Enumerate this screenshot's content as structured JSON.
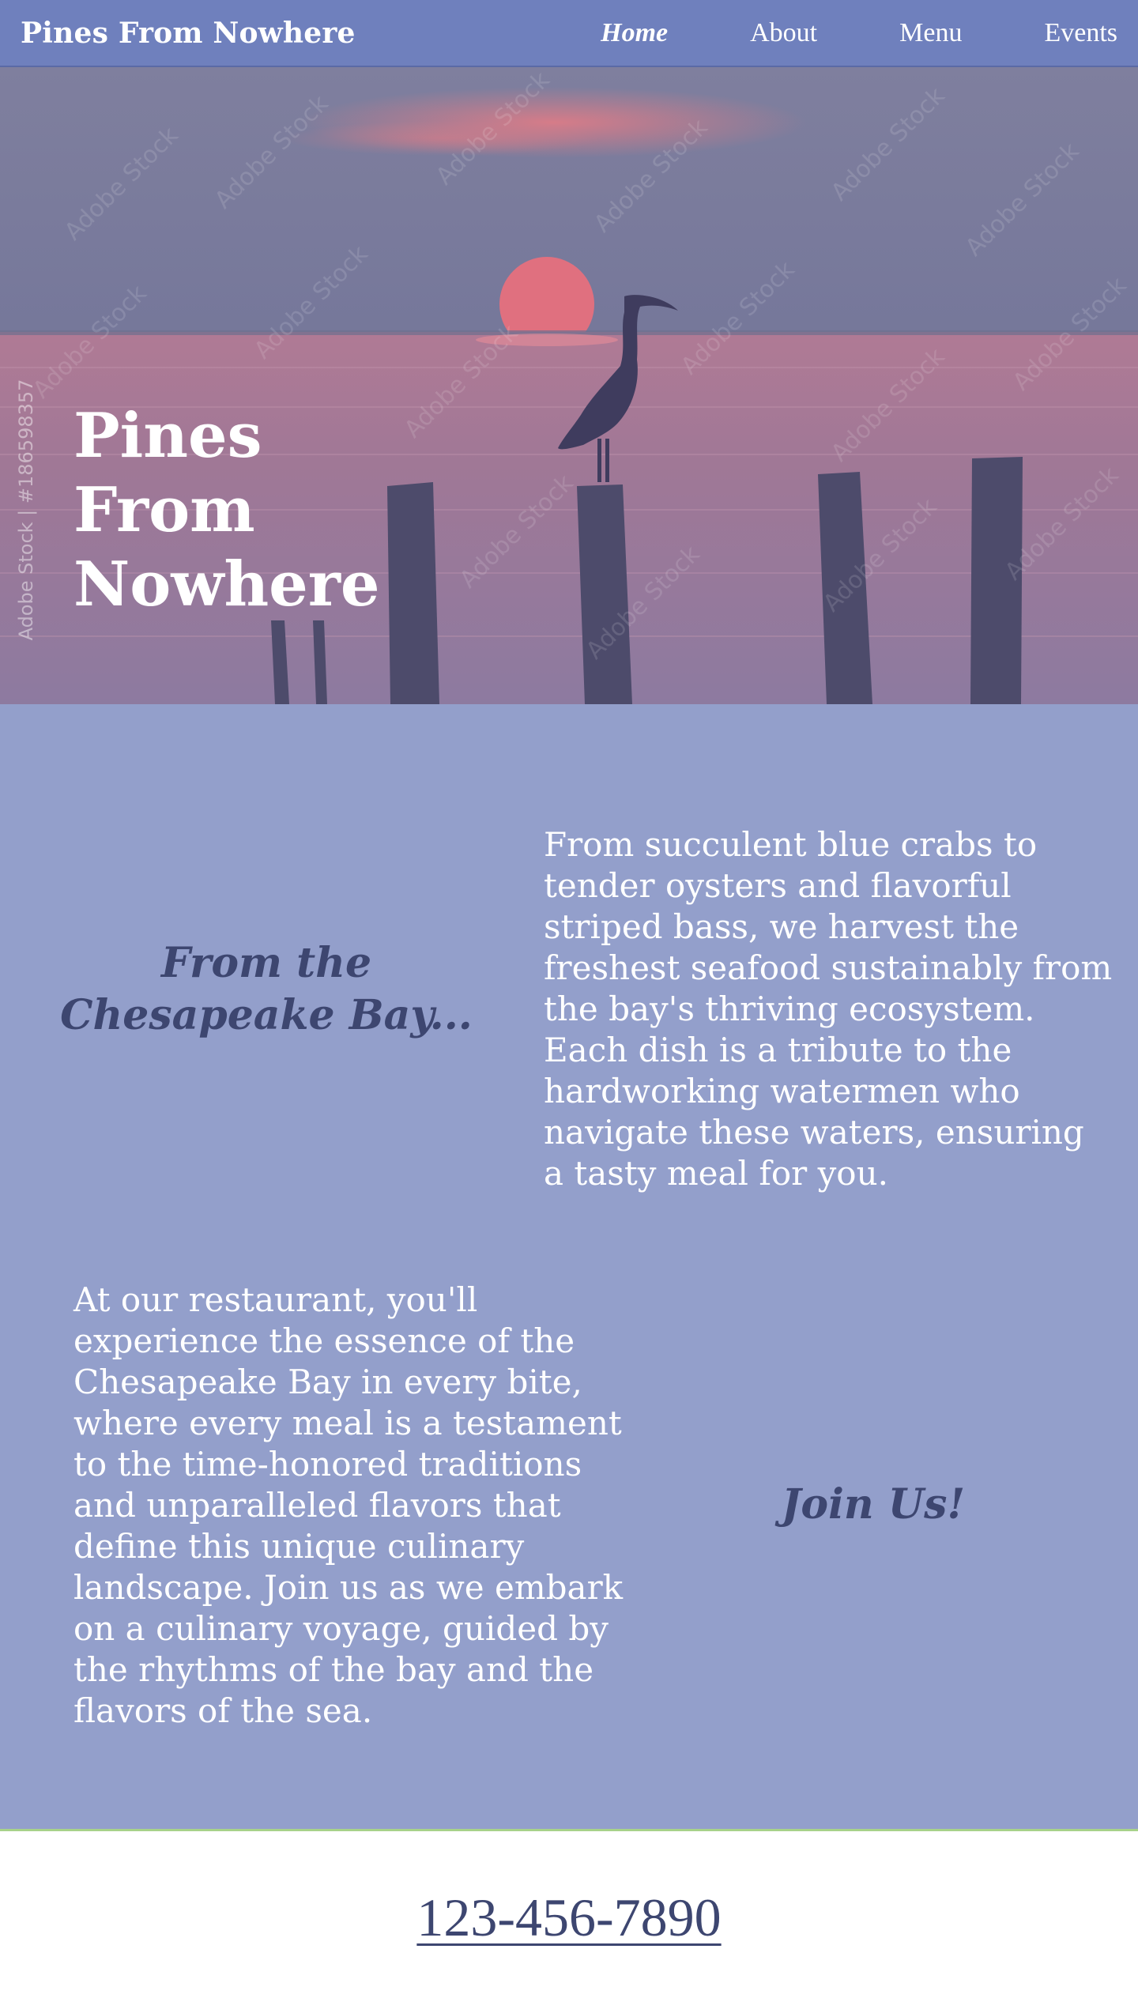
{
  "nav": {
    "brand": "Pines From Nowhere",
    "links": [
      {
        "label": "Home",
        "active": true
      },
      {
        "label": "About",
        "active": false
      },
      {
        "label": "Menu",
        "active": false
      },
      {
        "label": "Events",
        "active": false
      }
    ]
  },
  "hero": {
    "title": "Pines From Nowhere",
    "watermark_side": "Adobe Stock | #186598357",
    "watermark_tile": "Adobe Stock"
  },
  "section": {
    "heading_1": "From the Chesapeake Bay...",
    "paragraph_1": "From succulent blue crabs to tender oysters and flavorful striped bass, we harvest the freshest seafood sustainably from the bay's thriving ecosystem.\nEach dish is a tribute to the hardworking watermen who navigate these waters, ensuring a tasty meal for you.",
    "paragraph_2": "At our restaurant, you'll experience the essence of the Chesapeake Bay in every bite, where every meal is a testament to the time-honored traditions and unparalleled flavors that define this unique culinary landscape. Join us as we embark on a culinary voyage, guided by the rhythms of the bay and the flavors of the sea.",
    "heading_2": "Join Us!"
  },
  "footer": {
    "phone": "123-456-7890"
  },
  "colors": {
    "navbar": "#6f80bd",
    "section_bg": "#939fcb",
    "heading_text": "#3d4670",
    "footer_border": "#a8d28a"
  }
}
